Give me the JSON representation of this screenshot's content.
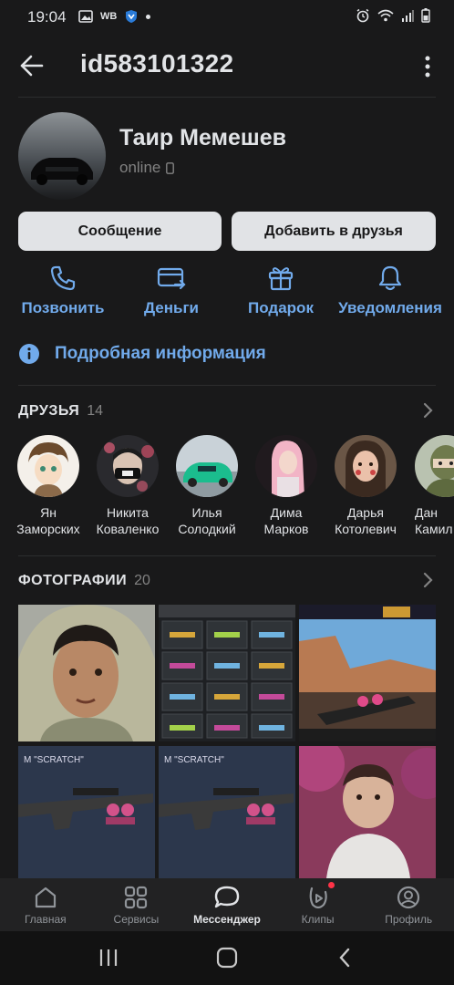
{
  "status_bar": {
    "time": "19:04",
    "carrier": "WB"
  },
  "header": {
    "title": "id583101322"
  },
  "profile": {
    "name": "Таир Мемешев",
    "status": "online",
    "message_button": "Сообщение",
    "add_friend_button": "Добавить в друзья"
  },
  "actions": [
    {
      "label": "Позвонить",
      "icon": "phone-icon"
    },
    {
      "label": "Деньги",
      "icon": "money-transfer-icon"
    },
    {
      "label": "Подарок",
      "icon": "gift-icon"
    },
    {
      "label": "Уведомления",
      "icon": "bell-icon"
    }
  ],
  "info_link": "Подробная информация",
  "friends": {
    "title": "ДРУЗЬЯ",
    "count": "14",
    "items": [
      {
        "first": "Ян",
        "last": "Заморских"
      },
      {
        "first": "Никита",
        "last": "Коваленко"
      },
      {
        "first": "Илья",
        "last": "Солодкий"
      },
      {
        "first": "Дима",
        "last": "Марков"
      },
      {
        "first": "Дарья",
        "last": "Котолевич"
      },
      {
        "first": "Дан",
        "last": "Камил"
      }
    ]
  },
  "photos": {
    "title": "ФОТОГРАФИИ",
    "count": "20"
  },
  "tabbar": {
    "items": [
      {
        "label": "Главная",
        "icon": "home-icon"
      },
      {
        "label": "Сервисы",
        "icon": "services-icon"
      },
      {
        "label": "Мессенджер",
        "icon": "messenger-icon"
      },
      {
        "label": "Клипы",
        "icon": "clips-icon"
      },
      {
        "label": "Профиль",
        "icon": "profile-icon"
      }
    ],
    "active": "Мессенджер"
  },
  "colors": {
    "background": "#19191a",
    "accent": "#71aaeb",
    "button_bg": "#e1e3e6",
    "secondary_text": "#828282",
    "tabbar_bg": "#222223",
    "notification_dot": "#ff3347"
  }
}
